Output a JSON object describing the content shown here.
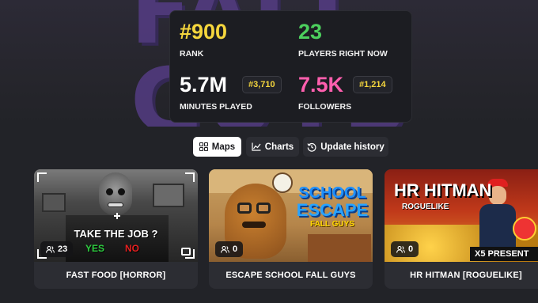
{
  "hero": {
    "logo_text": "FALL GUYS"
  },
  "stats": {
    "rank": {
      "value": "#900",
      "label": "RANK"
    },
    "players": {
      "value": "23",
      "label": "PLAYERS RIGHT NOW"
    },
    "minutes": {
      "value": "5.7M",
      "label": "MINUTES PLAYED",
      "badge": "#3,710"
    },
    "followers": {
      "value": "7.5K",
      "label": "FOLLOWERS",
      "badge": "#1,214"
    },
    "colors": {
      "rank": "#f5d63d",
      "players": "#4ccf5d",
      "minutes": "#ffffff",
      "followers": "#ff5fae",
      "badge": "#f5d63d"
    }
  },
  "tabs": [
    {
      "label": "Maps",
      "icon": "grid-icon",
      "active": true
    },
    {
      "label": "Charts",
      "icon": "chart-line-icon",
      "active": false
    },
    {
      "label": "Update history",
      "icon": "history-icon",
      "active": false
    }
  ],
  "maps": [
    {
      "title": "FAST FOOD [HORROR]",
      "players": "23",
      "thumb_text": "TAKE THE JOB ?",
      "yes": "YES",
      "no": "NO"
    },
    {
      "title": "ESCAPE SCHOOL FALL GUYS",
      "players": "0",
      "thumb_line1": "SCHOOL",
      "thumb_line2": "ESCAPE",
      "thumb_line3": "FALL GUYS"
    },
    {
      "title": "HR HITMAN [ROGUELIKE]",
      "players": "0",
      "thumb_line1": "HR HITMAN",
      "thumb_line2": "ROGUELIKE",
      "thumb_line3": "X5 PRESENT"
    }
  ]
}
